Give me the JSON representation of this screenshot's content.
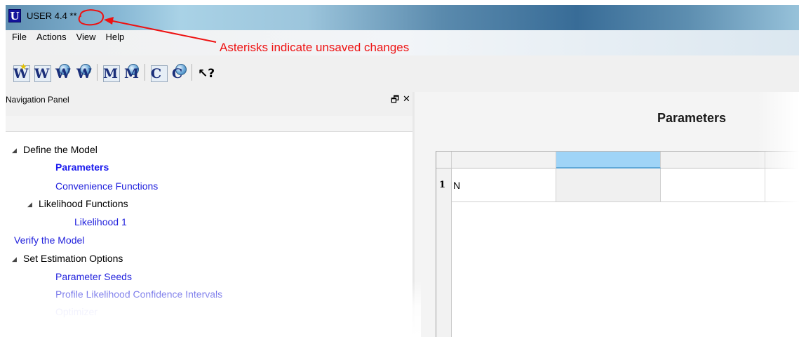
{
  "window": {
    "app_icon_letter": "U",
    "title": "USER 4.4 **"
  },
  "annotation": {
    "text": "Asterisks indicate unsaved changes",
    "color": "#ee1111"
  },
  "menubar": {
    "items": [
      "File",
      "Actions",
      "View",
      "Help"
    ]
  },
  "toolbar": {
    "buttons": [
      {
        "name": "new-w-button",
        "glyph": "W",
        "icon": "new-document-icon"
      },
      {
        "name": "w-button-2",
        "glyph": "W",
        "icon": "w-tool-icon"
      },
      {
        "name": "w-globe-button",
        "glyph": "W",
        "icon": "w-globe-icon"
      },
      {
        "name": "w-globe-button-2",
        "glyph": "W",
        "icon": "w-globe-icon"
      },
      {
        "name": "m-button",
        "glyph": "M",
        "icon": "m-tool-icon"
      },
      {
        "name": "m-globe-button",
        "glyph": "M",
        "icon": "m-globe-icon"
      },
      {
        "name": "c-button",
        "glyph": "C",
        "icon": "c-tool-icon"
      },
      {
        "name": "c-globe-button",
        "glyph": "C",
        "icon": "c-globe-icon"
      },
      {
        "name": "help-pointer-button",
        "glyph": "↖?",
        "icon": "whats-this-help-icon"
      }
    ]
  },
  "nav_panel": {
    "title": "Navigation Panel",
    "float_glyph": "🗗",
    "close_glyph": "✕",
    "tree": [
      {
        "label": "Define the Model",
        "style": "static",
        "expanded": true
      },
      {
        "label": "Parameters",
        "style": "link-bold"
      },
      {
        "label": "Convenience Functions",
        "style": "link"
      },
      {
        "label": "Likelihood Functions",
        "style": "static",
        "expanded": true
      },
      {
        "label": "Likelihood 1",
        "style": "link"
      },
      {
        "label": "Verify the Model",
        "style": "link"
      },
      {
        "label": "Set Estimation Options",
        "style": "static",
        "expanded": true
      },
      {
        "label": "Parameter Seeds",
        "style": "link"
      },
      {
        "label": "Profile Likelihood Confidence Intervals",
        "style": "link"
      },
      {
        "label": "Optimizer",
        "style": "link"
      }
    ]
  },
  "content": {
    "title": "Parameters",
    "grid": {
      "rows": [
        {
          "number": "1",
          "name": "N",
          "value": ""
        }
      ]
    }
  },
  "colors": {
    "link": "#2222dd",
    "selected_header": "#9fd4f7"
  }
}
